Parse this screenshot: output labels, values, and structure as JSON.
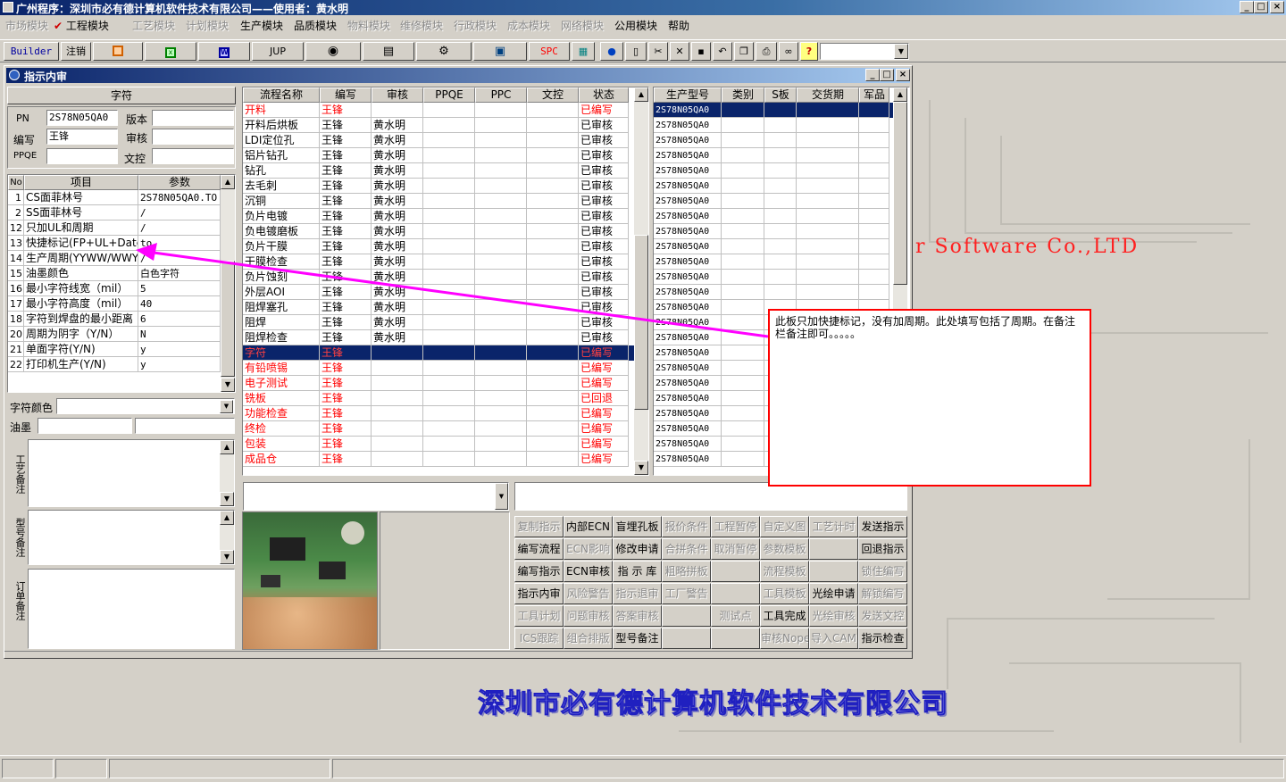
{
  "app": {
    "title": "广州程序：深圳市必有德计算机软件技术有限公司——使用者：黄水明",
    "min_label": "_",
    "max_label": "□",
    "close_label": "×"
  },
  "menu": [
    "市场模块",
    "✔ 工程模块",
    "工艺模块",
    "计划模块",
    "生产模块",
    "品质模块",
    "物料模块",
    "维修模块",
    "行政模块",
    "成本模块",
    "网络模块",
    "公用模块",
    "帮助"
  ],
  "menu_enabled": [
    false,
    true,
    false,
    false,
    true,
    true,
    false,
    false,
    false,
    false,
    false,
    true,
    true
  ],
  "toolbar": {
    "builder": "Builder",
    "logout": "注销",
    "jup": "JUP",
    "spc": "SPC",
    "help": "?",
    "combo_value": ""
  },
  "child": {
    "title": "指示内审",
    "section_title": "字符",
    "pn_label": "PN",
    "pn_value": "2S78N05QA0",
    "version_label": "版本",
    "version_value": "",
    "editor_label": "编写",
    "editor_value": "王锋",
    "review_label": "审核",
    "review_value": "",
    "ppqe_label": "PPQE",
    "ppqe_value": "",
    "dc_label": "文控",
    "dc_value": ""
  },
  "params": {
    "headers": [
      "No",
      "项目",
      "参数"
    ],
    "rows": [
      [
        "1",
        "CS面菲林号",
        "2S78N05QA0.TO"
      ],
      [
        "2",
        "SS面菲林号",
        "/"
      ],
      [
        "12",
        "只加UL和周期",
        "/"
      ],
      [
        "13",
        "快捷标记(FP+UL+DateCo",
        "to"
      ],
      [
        "14",
        "生产周期(YYWW/WWYY)",
        "/"
      ],
      [
        "15",
        "油墨颜色",
        "白色字符"
      ],
      [
        "16",
        "最小字符线宽（mil）",
        "5"
      ],
      [
        "17",
        "最小字符高度（mil）",
        "40"
      ],
      [
        "18",
        "字符到焊盘的最小距离（",
        "6"
      ],
      [
        "20",
        "周期为阴字（Y/N）",
        "N"
      ],
      [
        "21",
        "单面字符(Y/N)",
        "y"
      ],
      [
        "22",
        "打印机生产(Y/N)",
        "y"
      ]
    ]
  },
  "lower_left": {
    "color_label": "字符颜色",
    "color_value": "",
    "ink_label": "油墨",
    "ink_value1": "",
    "ink_value2": "",
    "process_note_label": "工艺备注",
    "model_note_label": "型号备注",
    "order_note_label": "订单备注"
  },
  "flow": {
    "headers": [
      "流程名称",
      "编写",
      "审核",
      "PPQE",
      "PPC",
      "文控",
      "状态"
    ],
    "rows": [
      [
        "开料",
        "王锋",
        "",
        "",
        "",
        "",
        "已编写",
        "red"
      ],
      [
        "开料后烘板",
        "王锋",
        "黄水明",
        "",
        "",
        "",
        "已审核",
        ""
      ],
      [
        "LDI定位孔",
        "王锋",
        "黄水明",
        "",
        "",
        "",
        "已审核",
        ""
      ],
      [
        "铝片钻孔",
        "王锋",
        "黄水明",
        "",
        "",
        "",
        "已审核",
        ""
      ],
      [
        "钻孔",
        "王锋",
        "黄水明",
        "",
        "",
        "",
        "已审核",
        ""
      ],
      [
        "去毛刺",
        "王锋",
        "黄水明",
        "",
        "",
        "",
        "已审核",
        ""
      ],
      [
        "沉铜",
        "王锋",
        "黄水明",
        "",
        "",
        "",
        "已审核",
        ""
      ],
      [
        "负片电镀",
        "王锋",
        "黄水明",
        "",
        "",
        "",
        "已审核",
        ""
      ],
      [
        "负电镀磨板",
        "王锋",
        "黄水明",
        "",
        "",
        "",
        "已审核",
        ""
      ],
      [
        "负片干膜",
        "王锋",
        "黄水明",
        "",
        "",
        "",
        "已审核",
        ""
      ],
      [
        "干膜检查",
        "王锋",
        "黄水明",
        "",
        "",
        "",
        "已审核",
        ""
      ],
      [
        "负片蚀刻",
        "王锋",
        "黄水明",
        "",
        "",
        "",
        "已审核",
        ""
      ],
      [
        "外层AOI",
        "王锋",
        "黄水明",
        "",
        "",
        "",
        "已审核",
        ""
      ],
      [
        "阻焊塞孔",
        "王锋",
        "黄水明",
        "",
        "",
        "",
        "已审核",
        ""
      ],
      [
        "阻焊",
        "王锋",
        "黄水明",
        "",
        "",
        "",
        "已审核",
        ""
      ],
      [
        "阻焊检查",
        "王锋",
        "黄水明",
        "",
        "",
        "",
        "已审核",
        ""
      ],
      [
        "字符",
        "王锋",
        "",
        "",
        "",
        "",
        "已编写",
        "sel"
      ],
      [
        "有铅喷锡",
        "王锋",
        "",
        "",
        "",
        "",
        "已编写",
        "red"
      ],
      [
        "电子测试",
        "王锋",
        "",
        "",
        "",
        "",
        "已编写",
        "red"
      ],
      [
        "铣板",
        "王锋",
        "",
        "",
        "",
        "",
        "已回退",
        "red"
      ],
      [
        "功能检查",
        "王锋",
        "",
        "",
        "",
        "",
        "已编写",
        "red"
      ],
      [
        "终检",
        "王锋",
        "",
        "",
        "",
        "",
        "已编写",
        "red"
      ],
      [
        "包装",
        "王锋",
        "",
        "",
        "",
        "",
        "已编写",
        "red"
      ],
      [
        "成品仓",
        "王锋",
        "",
        "",
        "",
        "",
        "已编写",
        "red"
      ]
    ]
  },
  "models": {
    "headers": [
      "生产型号",
      "类别",
      "S板",
      "交货期",
      "军品"
    ],
    "values": [
      "2S78N05QA0",
      "2S78N05QA0",
      "2S78N05QA0",
      "2S78N05QA0",
      "2S78N05QA0",
      "2S78N05QA0",
      "2S78N05QA0",
      "2S78N05QA0",
      "2S78N05QA0",
      "2S78N05QA0",
      "2S78N05QA0",
      "2S78N05QA0",
      "2S78N05QA0",
      "2S78N05QA0",
      "2S78N05QA0",
      "2S78N05QA0",
      "2S78N05QA0",
      "2S78N05QA0",
      "2S78N05QA0",
      "2S78N05QA0",
      "2S78N05QA0",
      "2S78N05QA0",
      "2S78N05QA0",
      "2S78N05QA0"
    ]
  },
  "buttons": [
    [
      [
        "复制指示",
        false
      ],
      [
        "内部ECN",
        true
      ],
      [
        "盲埋孔板",
        true
      ],
      [
        "报价条件",
        false
      ],
      [
        "工程暂停",
        false
      ],
      [
        "自定义图",
        false
      ],
      [
        "工艺计时",
        false
      ],
      [
        "发送指示",
        true
      ]
    ],
    [
      [
        "编写流程",
        true
      ],
      [
        "ECN影响",
        false
      ],
      [
        "修改申请",
        true
      ],
      [
        "合拼条件",
        false
      ],
      [
        "取消暂停",
        false
      ],
      [
        "参数模板",
        false
      ],
      [
        "",
        false
      ],
      [
        "回退指示",
        true
      ]
    ],
    [
      [
        "编写指示",
        true
      ],
      [
        "ECN审核",
        true
      ],
      [
        "指 示 库",
        true
      ],
      [
        "粗略拼板",
        false
      ],
      [
        "",
        false
      ],
      [
        "流程模板",
        false
      ],
      [
        "",
        false
      ],
      [
        "锁住编写",
        false
      ]
    ],
    [
      [
        "指示内审",
        true
      ],
      [
        "风险警告",
        false
      ],
      [
        "指示退审",
        false
      ],
      [
        "工厂警告",
        false
      ],
      [
        "",
        false
      ],
      [
        "工具模板",
        false
      ],
      [
        "光绘申请",
        true
      ],
      [
        "解锁编写",
        false
      ]
    ],
    [
      [
        "工具计划",
        false
      ],
      [
        "问题审核",
        false
      ],
      [
        "答案审核",
        false
      ],
      [
        "",
        false
      ],
      [
        "测试点",
        false
      ],
      [
        "工具完成",
        true
      ],
      [
        "光绘审核",
        false
      ],
      [
        "发送文控",
        false
      ]
    ],
    [
      [
        "ICS跟踪",
        false
      ],
      [
        "组合排版",
        false
      ],
      [
        "型号备注",
        true
      ],
      [
        "",
        false
      ],
      [
        "",
        false
      ],
      [
        "审核Nope",
        false
      ],
      [
        "导入CAM",
        false
      ],
      [
        "指示检查",
        true
      ]
    ]
  ],
  "note": {
    "text": "此板只加快捷标记，没有加周期。此处填写包括了周期。在备注栏备注即可。。。。。"
  },
  "background": {
    "brand_en": "er Software Co.,LTD",
    "brand_cn": "深圳市必有德计算机软件技术有限公司"
  },
  "colors": {
    "arrow": "#ff00ff",
    "note_border": "#ff0000",
    "selection": "#0a246a",
    "written_text": "#ff0000"
  }
}
